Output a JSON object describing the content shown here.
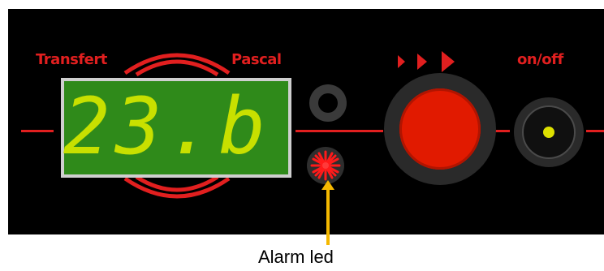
{
  "panel": {
    "brand_left": "Transfert",
    "brand_right": "Pascal",
    "display_value": "23.b",
    "onoff_label": "on/off",
    "colors": {
      "panel": "#000000",
      "accent": "#e11f1f",
      "lcd": "#2f8a1a",
      "digits": "#c8e000",
      "button": "#e11a00"
    }
  },
  "annotation": {
    "label": "Alarm led",
    "color": "#f5b800"
  },
  "icons": {
    "run": "triple-play-arrows-icon",
    "alarm": "starburst-led-icon",
    "power": "power-dot-icon"
  }
}
